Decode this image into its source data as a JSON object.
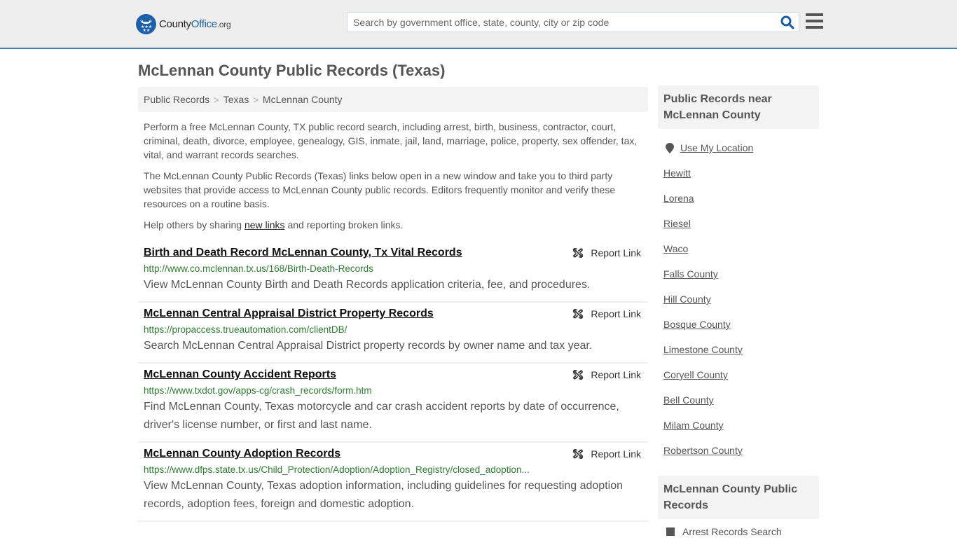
{
  "header": {
    "logo": {
      "county": "County",
      "office": "Office",
      "tld": ".org"
    },
    "search": {
      "placeholder": "Search by government office, state, county, city or zip code",
      "value": ""
    },
    "colors": {
      "brand": "#1d5fa8",
      "topbar_border": "#3b7db4"
    }
  },
  "page": {
    "title": "McLennan County Public Records (Texas)",
    "breadcrumb": [
      {
        "label": "Public Records"
      },
      {
        "label": "Texas"
      },
      {
        "label": "McLennan County"
      }
    ],
    "breadcrumb_separator": ">",
    "intro": {
      "p1": "Perform a free McLennan County, TX public record search, including arrest, birth, business, contractor, court, criminal, death, divorce, employee, genealogy, GIS, inmate, jail, land, marriage, police, property, sex offender, tax, vital, and warrant records searches.",
      "p2": "The McLennan County Public Records (Texas) links below open in a new window and take you to third party websites that provide access to McLennan County public records. Editors frequently monitor and verify these resources on a routine basis.",
      "p3_before": "Help others by sharing ",
      "p3_link": "new links",
      "p3_after": " and reporting broken links."
    }
  },
  "records": [
    {
      "title": "Birth and Death Record McLennan County, Tx Vital Records",
      "url": "http://www.co.mclennan.tx.us/168/Birth-Death-Records",
      "description": "View McLennan County Birth and Death Records application criteria, fee, and procedures.",
      "report_label": "Report Link"
    },
    {
      "title": "McLennan Central Appraisal District Property Records",
      "url": "https://propaccess.trueautomation.com/clientDB/",
      "description": "Search McLennan Central Appraisal District property records by owner name and tax year.",
      "report_label": "Report Link"
    },
    {
      "title": "McLennan County Accident Reports",
      "url": "https://www.txdot.gov/apps-cg/crash_records/form.htm",
      "description": "Find McLennan County, Texas motorcycle and car crash accident reports by date of occurrence, driver's license number, or first and last name.",
      "report_label": "Report Link"
    },
    {
      "title": "McLennan County Adoption Records",
      "url": "https://www.dfps.state.tx.us/Child_Protection/Adoption/Adoption_Registry/closed_adoption...",
      "description": "View McLennan County, Texas adoption information, including guidelines for requesting adoption records, adoption fees, foreign and domestic adoption.",
      "report_label": "Report Link"
    }
  ],
  "sidebar": {
    "nearby_heading": "Public Records near McLennan County",
    "use_location": "Use My Location",
    "nearby": [
      "Hewitt",
      "Lorena",
      "Riesel",
      "Waco",
      "Falls County",
      "Hill County",
      "Bosque County",
      "Limestone County",
      "Coryell County",
      "Bell County",
      "Milam County",
      "Robertson County"
    ],
    "county_heading": "McLennan County Public Records",
    "county_items": [
      "Arrest Records Search"
    ]
  }
}
